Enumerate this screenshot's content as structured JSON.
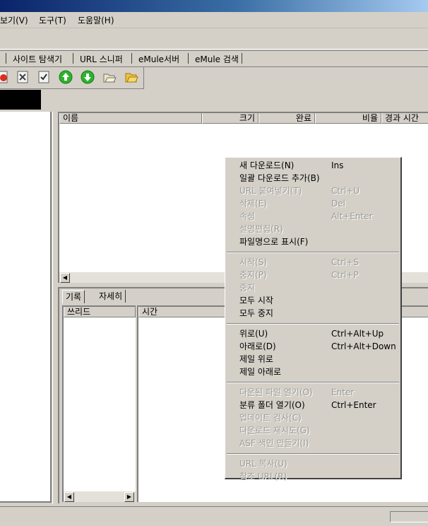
{
  "menubar": [
    "보기(V)",
    "도구(T)",
    "도움말(H)"
  ],
  "tabs": [
    "사이트 탐색기",
    "URL 스니퍼",
    "eMule서버",
    "eMule 검색"
  ],
  "toolbar_icons": [
    "stop-icon",
    "delete-icon",
    "properties-icon",
    "move-up-icon",
    "move-down-icon",
    "open-file-icon",
    "open-folder-icon"
  ],
  "download_list": {
    "columns": [
      "이름",
      "크기",
      "완료",
      "비율",
      "경과 시간"
    ]
  },
  "bottom": {
    "tabs": [
      "기록",
      "자세히"
    ],
    "columns": [
      "쓰리드",
      "시간"
    ]
  },
  "colors": {
    "menu_bg": "#d4d0c8",
    "disabled_text": "#9c9a95",
    "title_start": "#0a246a",
    "up_icon": "#2db22d",
    "down_icon": "#2db22d"
  },
  "context_menu": {
    "groups": [
      [
        {
          "label": "새 다운로드(N)",
          "shortcut": "Ins",
          "enabled": true
        },
        {
          "label": "일괄 다운로드 추가(B)",
          "shortcut": "",
          "enabled": true
        },
        {
          "label": "URL 붙여넣기(T)",
          "shortcut": "Ctrl+U",
          "enabled": false
        },
        {
          "label": "삭제(E)",
          "shortcut": "Del",
          "enabled": false
        },
        {
          "label": "속성",
          "shortcut": "Alt+Enter",
          "enabled": false
        },
        {
          "label": "설명편집(R)",
          "shortcut": "",
          "enabled": false
        },
        {
          "label": "파일명으로 표시(F)",
          "shortcut": "",
          "enabled": true
        }
      ],
      [
        {
          "label": "시작(S)",
          "shortcut": "Ctrl+S",
          "enabled": false
        },
        {
          "label": "중지(P)",
          "shortcut": "Ctrl+P",
          "enabled": false
        },
        {
          "label": "중지",
          "shortcut": "",
          "enabled": false
        },
        {
          "label": "모두 시작",
          "shortcut": "",
          "enabled": true
        },
        {
          "label": "모두 중지",
          "shortcut": "",
          "enabled": true
        }
      ],
      [
        {
          "label": "위로(U)",
          "shortcut": "Ctrl+Alt+Up",
          "enabled": true
        },
        {
          "label": "아래로(D)",
          "shortcut": "Ctrl+Alt+Down",
          "enabled": true
        },
        {
          "label": "제일 위로",
          "shortcut": "",
          "enabled": true
        },
        {
          "label": "제일 아래로",
          "shortcut": "",
          "enabled": true
        }
      ],
      [
        {
          "label": "다운된 파일 열기(O)",
          "shortcut": "Enter",
          "enabled": false
        },
        {
          "label": "분류 폴더 열기(O)",
          "shortcut": "Ctrl+Enter",
          "enabled": true
        },
        {
          "label": "업데이트 검사(C)",
          "shortcut": "",
          "enabled": false
        },
        {
          "label": "다운로드 재시도(G)",
          "shortcut": "",
          "enabled": false
        },
        {
          "label": "ASF 색인 만들기(I)",
          "shortcut": "",
          "enabled": false
        }
      ],
      [
        {
          "label": "URL 복사(U)",
          "shortcut": "",
          "enabled": false
        },
        {
          "label": "참조 URL(R)",
          "shortcut": "",
          "enabled": false
        }
      ]
    ]
  }
}
